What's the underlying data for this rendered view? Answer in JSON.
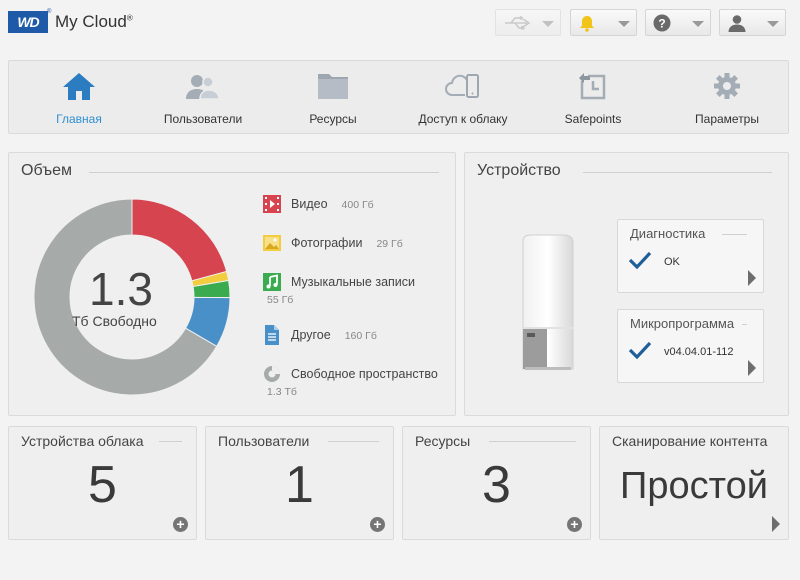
{
  "header": {
    "brand": "WD",
    "app_title": "My Cloud",
    "buttons": [
      {
        "icon": "usb-icon",
        "state": "disabled"
      },
      {
        "icon": "bell-icon",
        "state": "alert"
      },
      {
        "icon": "help-icon",
        "state": "normal"
      },
      {
        "icon": "user-icon",
        "state": "normal"
      }
    ]
  },
  "nav": {
    "items": [
      {
        "label": "Главная",
        "icon": "home-icon",
        "active": true
      },
      {
        "label": "Пользователи",
        "icon": "users-icon",
        "active": false
      },
      {
        "label": "Ресурсы",
        "icon": "folder-icon",
        "active": false
      },
      {
        "label": "Доступ к облаку",
        "icon": "cloud-device-icon",
        "active": false
      },
      {
        "label": "Safepoints",
        "icon": "safepoint-icon",
        "active": false
      },
      {
        "label": "Параметры",
        "icon": "gear-icon",
        "active": false
      }
    ]
  },
  "capacity": {
    "title": "Объем",
    "center_value": "1.3",
    "center_label": "Тб Свободно",
    "legend": [
      {
        "label": "Видео",
        "size": "400 Гб",
        "color": "#d5444f",
        "icon": "video-icon"
      },
      {
        "label": "Фотографии",
        "size": "29 Гб",
        "color": "#f2cd40",
        "icon": "photo-icon"
      },
      {
        "label": "Музыкальные записи",
        "size": "55 Гб",
        "color": "#3bab4f",
        "icon": "music-icon"
      },
      {
        "label": "Другое",
        "size": "160 Гб",
        "color": "#4a90c8",
        "icon": "document-icon"
      },
      {
        "label": "Свободное пространство",
        "size": "1.3 Тб",
        "color": "#a6aaa8",
        "icon": "free-space-icon"
      }
    ],
    "donut_fractions": [
      0.208,
      0.015,
      0.028,
      0.083,
      0.666
    ]
  },
  "device": {
    "title": "Устройство",
    "diagnostics": {
      "title": "Диагностика",
      "value": "OK"
    },
    "firmware": {
      "title": "Микропрограмма",
      "value": "v04.04.01-112"
    }
  },
  "tiles": [
    {
      "title": "Устройства облака",
      "value": "5"
    },
    {
      "title": "Пользователи",
      "value": "1"
    },
    {
      "title": "Ресурсы",
      "value": "3"
    },
    {
      "title": "Сканирование контента",
      "value": "Простой"
    }
  ],
  "colors": {
    "accent": "#2f8fd1",
    "brand": "#1e5aa8",
    "bell": "#f0c419"
  }
}
